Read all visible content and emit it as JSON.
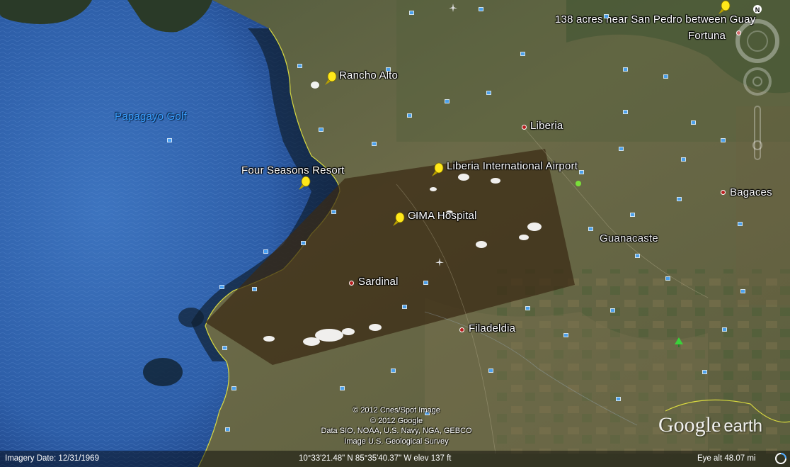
{
  "map": {
    "water_label": "Papagayo Golf",
    "region_label": "Guanacaste",
    "places": [
      {
        "id": "rancho-alto",
        "label": "Rancho Alto",
        "marker": "pushpin"
      },
      {
        "id": "four-seasons",
        "label": "Four Seasons Resort",
        "marker": "pushpin"
      },
      {
        "id": "liberia-airport",
        "label": "Liberia International Airport",
        "marker": "pushpin"
      },
      {
        "id": "cima-hospital",
        "label": "CIMA Hospital",
        "marker": "pushpin"
      },
      {
        "id": "liberia",
        "label": "Liberia",
        "marker": "town"
      },
      {
        "id": "bagaces",
        "label": "Bagaces",
        "marker": "town"
      },
      {
        "id": "fortuna",
        "label": "Fortuna",
        "marker": "town"
      },
      {
        "id": "sardinal",
        "label": "Sardinal",
        "marker": "town"
      },
      {
        "id": "filadeldia",
        "label": "Filadeldia",
        "marker": "town"
      },
      {
        "id": "san-pedro",
        "label": "138 acres near San Pedro between Guay",
        "marker": "pushpin"
      }
    ],
    "icons": {
      "compass_n": "N",
      "photo": "photo-icon",
      "pushpin": "pushpin-icon",
      "town": "town-dot-icon"
    },
    "colors": {
      "ocean": "#2f5fa8",
      "land": "#5a5a3a",
      "overlay": "#3a2a18",
      "water_label": "#3aa0ff",
      "pushpin": "#ffe81a",
      "town_dot": "#b81e1e",
      "photo_icon": "#4aa8ff",
      "coastline": "#f0f040"
    }
  },
  "credits": {
    "line1": "© 2012 Cnes/Spot Image",
    "line2": "© 2012 Google",
    "line3": "Data SIO, NOAA, U.S. Navy, NGA, GEBCO",
    "line4": "Image U.S. Geological Survey"
  },
  "logo": {
    "google": "Google",
    "earth": "earth"
  },
  "status": {
    "imagery_date": "Imagery Date: 12/31/1969",
    "coords": "10°33'21.48\" N  85°35'40.37\" W  elev   137 ft",
    "eye_alt": "Eye alt    48.07 mi"
  }
}
